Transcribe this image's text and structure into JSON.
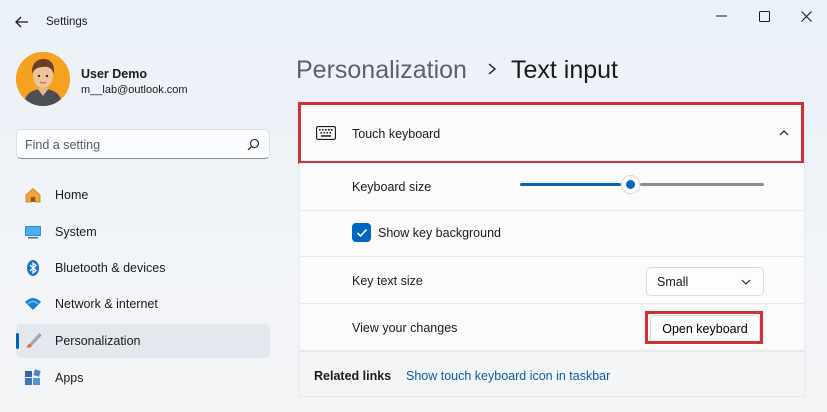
{
  "window": {
    "title": "Settings",
    "minimize_icon": "minimize-icon",
    "maximize_icon": "maximize-icon",
    "close_icon": "close-icon"
  },
  "profile": {
    "name": "User Demo",
    "email": "m__lab@outlook.com"
  },
  "search": {
    "placeholder": "Find a setting",
    "value": ""
  },
  "sidebar": {
    "items": [
      {
        "label": "Home",
        "icon": "home-icon",
        "active": false
      },
      {
        "label": "System",
        "icon": "monitor-icon",
        "active": false
      },
      {
        "label": "Bluetooth & devices",
        "icon": "bluetooth-icon",
        "active": false
      },
      {
        "label": "Network & internet",
        "icon": "wifi-icon",
        "active": false
      },
      {
        "label": "Personalization",
        "icon": "brush-icon",
        "active": true
      },
      {
        "label": "Apps",
        "icon": "apps-icon",
        "active": false
      }
    ]
  },
  "header": {
    "parent": "Personalization",
    "current": "Text input"
  },
  "touch_keyboard": {
    "title": "Touch keyboard",
    "expanded": true,
    "keyboard_size_label": "Keyboard size",
    "keyboard_size_fraction": 0.45,
    "show_key_background_label": "Show key background",
    "show_key_background_checked": true,
    "key_text_size_label": "Key text size",
    "key_text_size_value": "Small",
    "view_changes_label": "View your changes",
    "open_keyboard_label": "Open keyboard"
  },
  "related": {
    "title": "Related links",
    "link": "Show touch keyboard icon in taskbar"
  },
  "colors": {
    "accent": "#0067c0",
    "highlight_outline": "#d0303b"
  }
}
